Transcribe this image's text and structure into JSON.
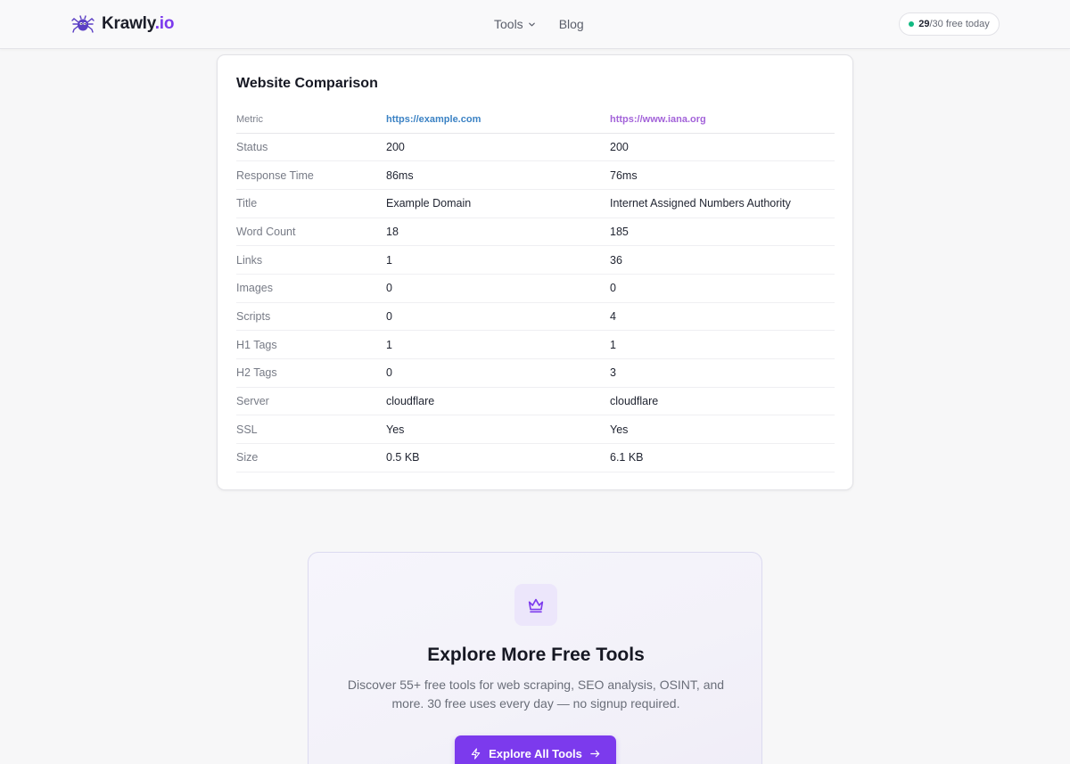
{
  "header": {
    "brand": {
      "name": "Krawly",
      "tld": ".io"
    },
    "nav": [
      {
        "label": "Tools",
        "has_dropdown": true
      },
      {
        "label": "Blog",
        "has_dropdown": false
      }
    ],
    "usage": {
      "used": "29",
      "rest": "/30 free today",
      "dot_color": "#10b981"
    }
  },
  "comparison": {
    "title": "Website Comparison",
    "columns": [
      "Metric",
      "https://example.com",
      "https://www.iana.org"
    ],
    "column_colors": [
      "#7b7f8b",
      "#3b82c4",
      "#a363d9"
    ],
    "rows": [
      [
        "Status",
        "200",
        "200"
      ],
      [
        "Response Time",
        "86ms",
        "76ms"
      ],
      [
        "Title",
        "Example Domain",
        "Internet Assigned Numbers Authority"
      ],
      [
        "Word Count",
        "18",
        "185"
      ],
      [
        "Links",
        "1",
        "36"
      ],
      [
        "Images",
        "0",
        "0"
      ],
      [
        "Scripts",
        "0",
        "4"
      ],
      [
        "H1 Tags",
        "1",
        "1"
      ],
      [
        "H2 Tags",
        "0",
        "3"
      ],
      [
        "Server",
        "cloudflare",
        "cloudflare"
      ],
      [
        "SSL",
        "Yes",
        "Yes"
      ],
      [
        "Size",
        "0.5 KB",
        "6.1 KB"
      ]
    ]
  },
  "cta": {
    "icon": "crown-icon",
    "title": "Explore More Free Tools",
    "description": "Discover 55+ free tools for web scraping, SEO analysis, OSINT, and more. 30 free uses every day — no signup required.",
    "button_label": "Explore All Tools",
    "accent": "#7c3aed"
  }
}
